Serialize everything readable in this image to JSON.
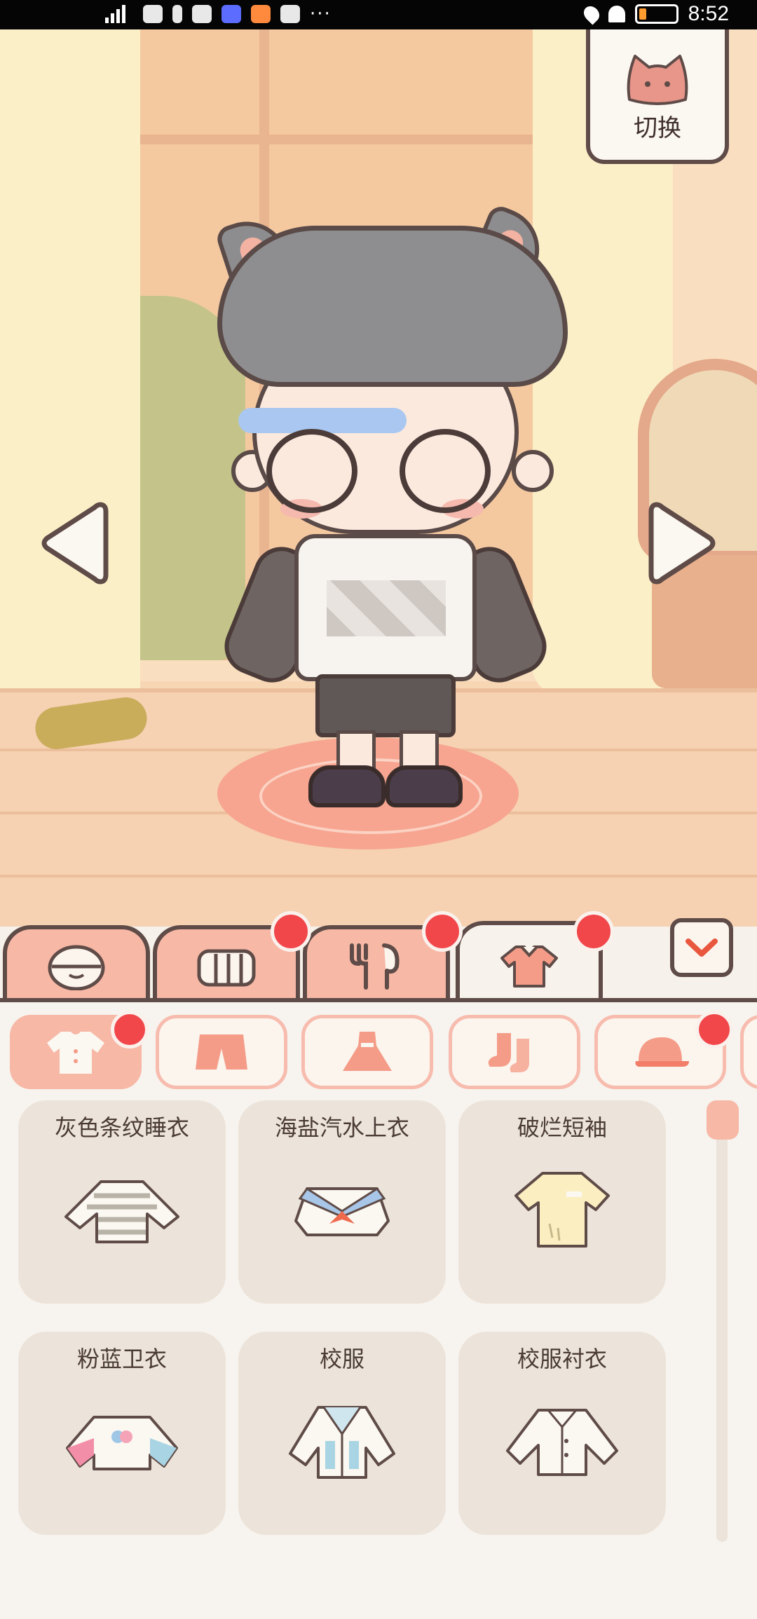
{
  "status_bar": {
    "time": "8:52",
    "overflow_dots": "···"
  },
  "scene": {
    "switch_button_label": "切换",
    "prev_outfit_icon": "left-arrow-icon",
    "next_outfit_icon": "right-arrow-icon"
  },
  "category_tabs": [
    {
      "name": "face",
      "icon": "face-icon",
      "badge": false,
      "active": false
    },
    {
      "name": "hair",
      "icon": "hair-icon",
      "badge": true,
      "active": false
    },
    {
      "name": "accessories",
      "icon": "accessory-icon",
      "badge": true,
      "active": false
    },
    {
      "name": "clothing",
      "icon": "shirt-icon",
      "badge": true,
      "active": true
    }
  ],
  "sub_tabs": [
    {
      "icon": "top-icon",
      "active": true,
      "badge": true
    },
    {
      "icon": "shorts-icon",
      "active": false,
      "badge": false
    },
    {
      "icon": "dress-icon",
      "active": false,
      "badge": false
    },
    {
      "icon": "socks-icon",
      "active": false,
      "badge": false
    },
    {
      "icon": "cap-icon",
      "active": false,
      "badge": true
    }
  ],
  "items": [
    {
      "name": "灰色条纹睡衣",
      "icon": "striped-sweater-icon"
    },
    {
      "name": "海盐汽水上衣",
      "icon": "sailor-top-icon"
    },
    {
      "name": "破烂短袖",
      "icon": "torn-tshirt-icon"
    },
    {
      "name": "粉蓝卫衣",
      "icon": "pink-blue-hoodie-icon"
    },
    {
      "name": "校服",
      "icon": "school-uniform-icon"
    },
    {
      "name": "校服衬衣",
      "icon": "school-shirt-icon"
    }
  ],
  "colors": {
    "accent_pink": "#f7b8a6",
    "badge_red": "#f1474b",
    "outline_brown": "#5f4b47",
    "panel_bg": "#f7f3ee",
    "card_bg": "#ece4da"
  }
}
